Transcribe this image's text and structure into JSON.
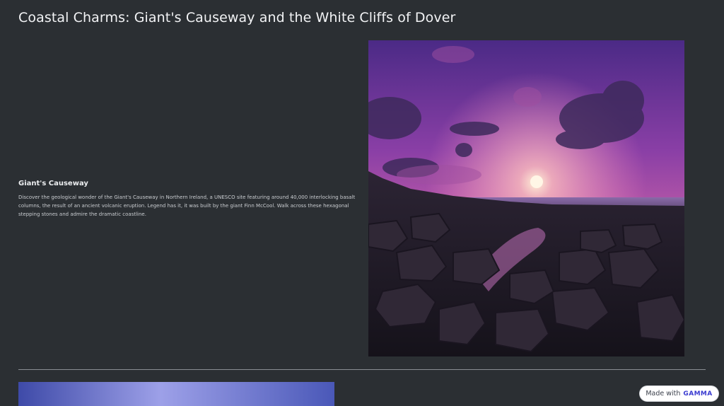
{
  "page": {
    "title": "Coastal Charms: Giant's Causeway and the White Cliffs of Dover"
  },
  "section": {
    "heading": "Giant's Causeway",
    "body": "Discover the geological wonder of the Giant's Causeway in Northern Ireland, a UNESCO site featuring around 40,000 interlocking basalt columns, the result of an ancient volcanic eruption. Legend has it, it was built by the giant Finn McCool. Walk across these hexagonal stepping stones and admire the dramatic coastline."
  },
  "badge": {
    "prefix": "Made with",
    "brand": "GAMMA"
  },
  "colors": {
    "background": "#2b2f33",
    "sky_top": "#5a2f8a",
    "sky_glow": "#e86bb0",
    "rock": "#1e1a24"
  }
}
